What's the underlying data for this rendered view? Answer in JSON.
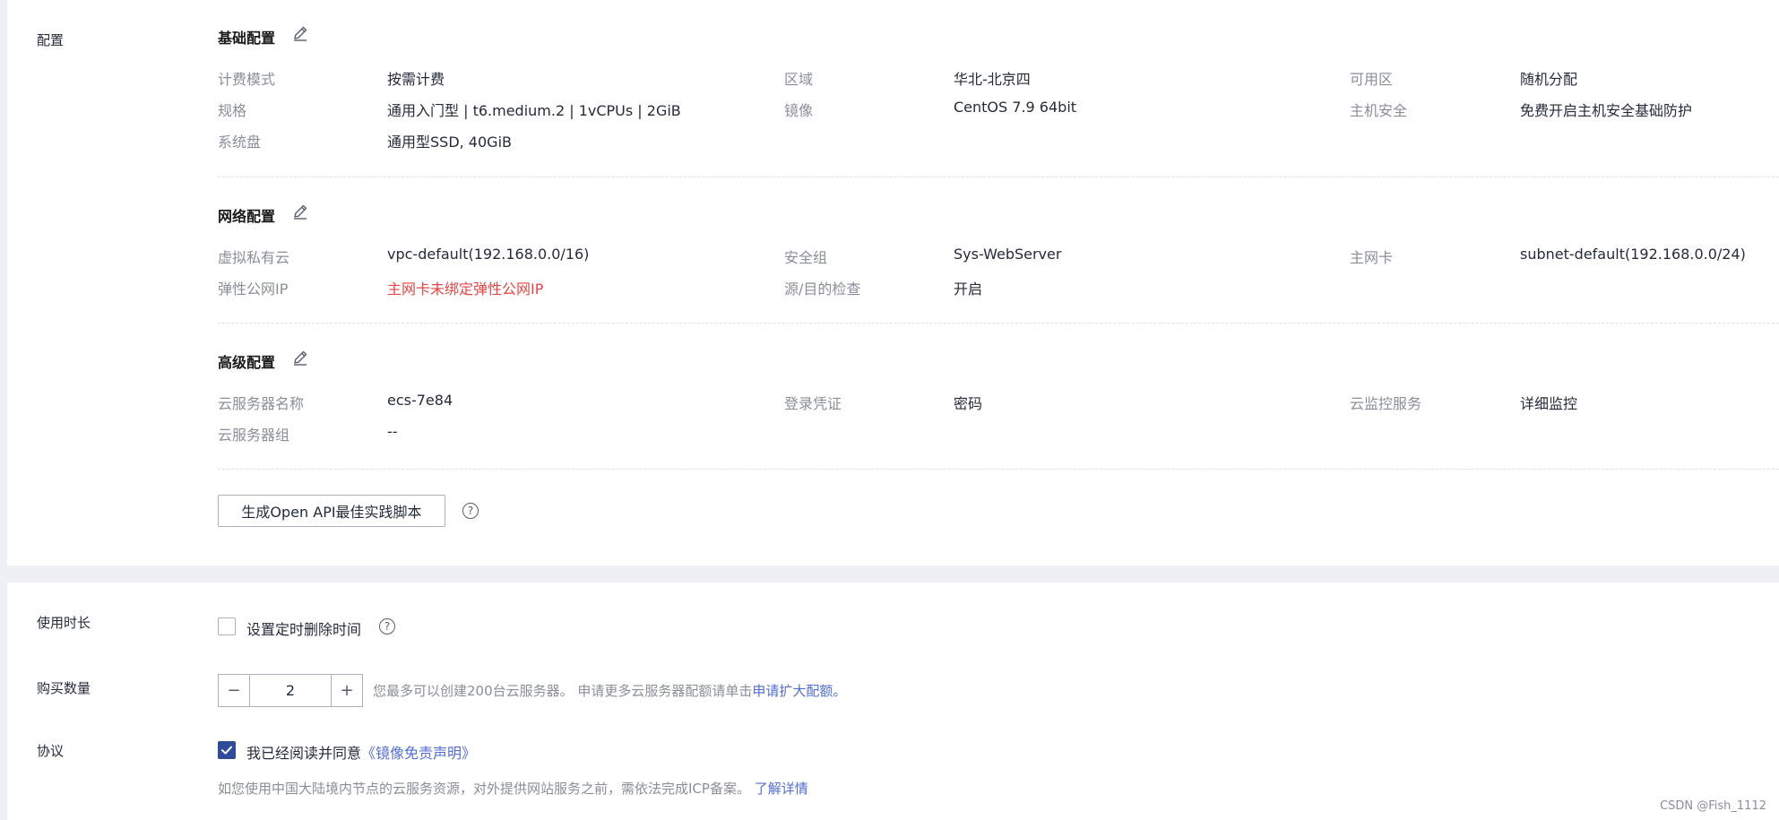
{
  "config": {
    "side_label": "配置",
    "basic": {
      "title": "基础配置",
      "billing_label": "计费模式",
      "billing_value": "按需计费",
      "region_label": "区域",
      "region_value": "华北-北京四",
      "az_label": "可用区",
      "az_value": "随机分配",
      "flavor_label": "规格",
      "flavor_value": "通用入门型 | t6.medium.2 | 1vCPUs | 2GiB",
      "image_label": "镜像",
      "image_value": "CentOS 7.9 64bit",
      "hss_label": "主机安全",
      "hss_value": "免费开启主机安全基础防护",
      "disk_label": "系统盘",
      "disk_value": "通用型SSD, 40GiB"
    },
    "network": {
      "title": "网络配置",
      "vpc_label": "虚拟私有云",
      "vpc_value": "vpc-default(192.168.0.0/16)",
      "sg_label": "安全组",
      "sg_value": "Sys-WebServer",
      "nic_label": "主网卡",
      "nic_value": "subnet-default(192.168.0.0/24)",
      "eip_label": "弹性公网IP",
      "eip_value": "主网卡未绑定弹性公网IP",
      "srcdst_label": "源/目的检查",
      "srcdst_value": "开启"
    },
    "advanced": {
      "title": "高级配置",
      "name_label": "云服务器名称",
      "name_value": "ecs-7e84",
      "login_label": "登录凭证",
      "login_value": "密码",
      "ces_label": "云监控服务",
      "ces_value": "详细监控",
      "group_label": "云服务器组",
      "group_value": "--"
    },
    "api_button": "生成Open API最佳实践脚本",
    "help_glyph": "?"
  },
  "duration": {
    "label": "使用时长",
    "checkbox_label": "设置定时删除时间",
    "checked": false
  },
  "quantity": {
    "label": "购买数量",
    "value": "2",
    "minus": "−",
    "plus": "+",
    "hint": "您最多可以创建200台云服务器。 申请更多云服务器配额请单击",
    "hint_link": "申请扩大配额",
    "hint_end": "。"
  },
  "agreement": {
    "label": "协议",
    "checked": true,
    "text": "我已经阅读并同意",
    "link": "《镜像免责声明》",
    "icp_note": "如您使用中国大陆境内节点的云服务资源，对外提供网站服务之前，需依法完成ICP备案。",
    "icp_link": "了解详情"
  },
  "watermark": "CSDN @Fish_1112",
  "colors": {
    "accent": "#526ecc",
    "checkbox_checked": "#2f4b99",
    "warning": "#e54545"
  }
}
